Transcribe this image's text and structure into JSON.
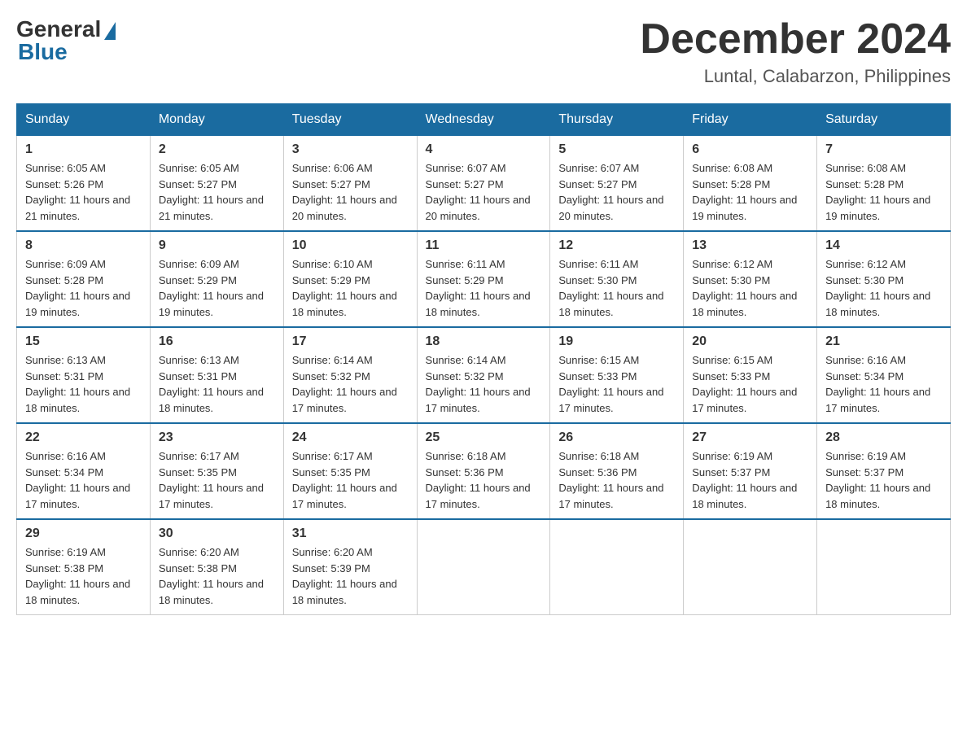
{
  "header": {
    "logo_general": "General",
    "logo_blue": "Blue",
    "month_title": "December 2024",
    "location": "Luntal, Calabarzon, Philippines"
  },
  "days_of_week": [
    "Sunday",
    "Monday",
    "Tuesday",
    "Wednesday",
    "Thursday",
    "Friday",
    "Saturday"
  ],
  "weeks": [
    [
      {
        "day": "1",
        "sunrise": "6:05 AM",
        "sunset": "5:26 PM",
        "daylight": "11 hours and 21 minutes."
      },
      {
        "day": "2",
        "sunrise": "6:05 AM",
        "sunset": "5:27 PM",
        "daylight": "11 hours and 21 minutes."
      },
      {
        "day": "3",
        "sunrise": "6:06 AM",
        "sunset": "5:27 PM",
        "daylight": "11 hours and 20 minutes."
      },
      {
        "day": "4",
        "sunrise": "6:07 AM",
        "sunset": "5:27 PM",
        "daylight": "11 hours and 20 minutes."
      },
      {
        "day": "5",
        "sunrise": "6:07 AM",
        "sunset": "5:27 PM",
        "daylight": "11 hours and 20 minutes."
      },
      {
        "day": "6",
        "sunrise": "6:08 AM",
        "sunset": "5:28 PM",
        "daylight": "11 hours and 19 minutes."
      },
      {
        "day": "7",
        "sunrise": "6:08 AM",
        "sunset": "5:28 PM",
        "daylight": "11 hours and 19 minutes."
      }
    ],
    [
      {
        "day": "8",
        "sunrise": "6:09 AM",
        "sunset": "5:28 PM",
        "daylight": "11 hours and 19 minutes."
      },
      {
        "day": "9",
        "sunrise": "6:09 AM",
        "sunset": "5:29 PM",
        "daylight": "11 hours and 19 minutes."
      },
      {
        "day": "10",
        "sunrise": "6:10 AM",
        "sunset": "5:29 PM",
        "daylight": "11 hours and 18 minutes."
      },
      {
        "day": "11",
        "sunrise": "6:11 AM",
        "sunset": "5:29 PM",
        "daylight": "11 hours and 18 minutes."
      },
      {
        "day": "12",
        "sunrise": "6:11 AM",
        "sunset": "5:30 PM",
        "daylight": "11 hours and 18 minutes."
      },
      {
        "day": "13",
        "sunrise": "6:12 AM",
        "sunset": "5:30 PM",
        "daylight": "11 hours and 18 minutes."
      },
      {
        "day": "14",
        "sunrise": "6:12 AM",
        "sunset": "5:30 PM",
        "daylight": "11 hours and 18 minutes."
      }
    ],
    [
      {
        "day": "15",
        "sunrise": "6:13 AM",
        "sunset": "5:31 PM",
        "daylight": "11 hours and 18 minutes."
      },
      {
        "day": "16",
        "sunrise": "6:13 AM",
        "sunset": "5:31 PM",
        "daylight": "11 hours and 18 minutes."
      },
      {
        "day": "17",
        "sunrise": "6:14 AM",
        "sunset": "5:32 PM",
        "daylight": "11 hours and 17 minutes."
      },
      {
        "day": "18",
        "sunrise": "6:14 AM",
        "sunset": "5:32 PM",
        "daylight": "11 hours and 17 minutes."
      },
      {
        "day": "19",
        "sunrise": "6:15 AM",
        "sunset": "5:33 PM",
        "daylight": "11 hours and 17 minutes."
      },
      {
        "day": "20",
        "sunrise": "6:15 AM",
        "sunset": "5:33 PM",
        "daylight": "11 hours and 17 minutes."
      },
      {
        "day": "21",
        "sunrise": "6:16 AM",
        "sunset": "5:34 PM",
        "daylight": "11 hours and 17 minutes."
      }
    ],
    [
      {
        "day": "22",
        "sunrise": "6:16 AM",
        "sunset": "5:34 PM",
        "daylight": "11 hours and 17 minutes."
      },
      {
        "day": "23",
        "sunrise": "6:17 AM",
        "sunset": "5:35 PM",
        "daylight": "11 hours and 17 minutes."
      },
      {
        "day": "24",
        "sunrise": "6:17 AM",
        "sunset": "5:35 PM",
        "daylight": "11 hours and 17 minutes."
      },
      {
        "day": "25",
        "sunrise": "6:18 AM",
        "sunset": "5:36 PM",
        "daylight": "11 hours and 17 minutes."
      },
      {
        "day": "26",
        "sunrise": "6:18 AM",
        "sunset": "5:36 PM",
        "daylight": "11 hours and 17 minutes."
      },
      {
        "day": "27",
        "sunrise": "6:19 AM",
        "sunset": "5:37 PM",
        "daylight": "11 hours and 18 minutes."
      },
      {
        "day": "28",
        "sunrise": "6:19 AM",
        "sunset": "5:37 PM",
        "daylight": "11 hours and 18 minutes."
      }
    ],
    [
      {
        "day": "29",
        "sunrise": "6:19 AM",
        "sunset": "5:38 PM",
        "daylight": "11 hours and 18 minutes."
      },
      {
        "day": "30",
        "sunrise": "6:20 AM",
        "sunset": "5:38 PM",
        "daylight": "11 hours and 18 minutes."
      },
      {
        "day": "31",
        "sunrise": "6:20 AM",
        "sunset": "5:39 PM",
        "daylight": "11 hours and 18 minutes."
      },
      null,
      null,
      null,
      null
    ]
  ]
}
